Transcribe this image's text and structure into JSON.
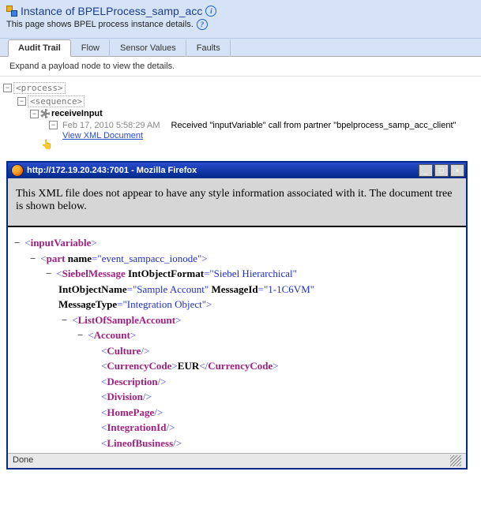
{
  "header": {
    "title": "Instance of BPELProcess_samp_acc",
    "subtitle": "This page shows BPEL process instance details."
  },
  "tabs": {
    "items": [
      {
        "label": "Audit Trail",
        "active": true
      },
      {
        "label": "Flow",
        "active": false
      },
      {
        "label": "Sensor Values",
        "active": false
      },
      {
        "label": "Faults",
        "active": false
      }
    ]
  },
  "instruction": "Expand a payload node to view the details.",
  "tree": {
    "process": "<process>",
    "sequence": "<sequence>",
    "receive": "receiveInput",
    "event": {
      "timestamp": "Feb 17, 2010 5:58:29 AM",
      "link": "View XML Document",
      "message": "Received \"inputVariable\" call from partner \"bpelprocess_samp_acc_client\""
    }
  },
  "popup": {
    "title": "http://172.19.20.243:7001 - Mozilla Firefox",
    "message": "This XML file does not appear to have any style information associated with it. The document tree is shown below.",
    "status": "Done",
    "xml": {
      "root": "inputVariable",
      "part_el": "part",
      "part_name_attr": "name",
      "part_name_val": "\"event_sampacc_ionode\"",
      "siebel_el": "SiebelMessage",
      "siebel_a1n": "IntObjectFormat",
      "siebel_a1v": "\"Siebel Hierarchical\"",
      "siebel_a2n": "IntObjectName",
      "siebel_a2v": "\"Sample Account\"",
      "siebel_a3n": "MessageId",
      "siebel_a3v": "\"1-1C6VM\"",
      "siebel_a4n": "MessageType",
      "siebel_a4v": "\"Integration Object\"",
      "list_el": "ListOfSampleAccount",
      "acct_el": "Account",
      "children": {
        "c1": "Culture",
        "c2": "CurrencyCode",
        "c2_text": "EUR",
        "c3": "Description",
        "c4": "Division",
        "c5": "HomePage",
        "c6": "IntegrationId",
        "c7": "LineofBusiness"
      }
    }
  }
}
